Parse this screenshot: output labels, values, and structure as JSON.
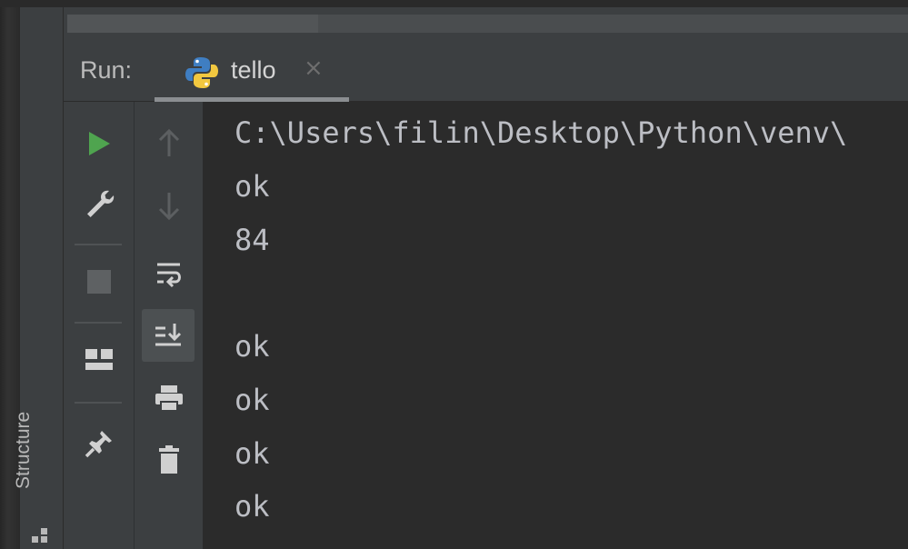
{
  "sidebar": {
    "structure_label": "Structure"
  },
  "run_panel": {
    "label": "Run:",
    "tab": {
      "name": "tello",
      "close_glyph": "×"
    }
  },
  "console": {
    "lines": [
      "C:\\Users\\filin\\Desktop\\Python\\venv\\",
      "ok",
      "84",
      "",
      "ok",
      "ok",
      "ok",
      "ok"
    ]
  },
  "icons": {
    "run": "play-icon",
    "rerun_settings": "wrench-icon",
    "stop": "stop-icon",
    "layout": "layout-icon",
    "pin": "pin-icon",
    "up": "arrow-up-icon",
    "down": "arrow-down-icon",
    "soft_wrap": "soft-wrap-icon",
    "scroll_to_end": "scroll-to-end-icon",
    "print": "print-icon",
    "clear": "trash-icon",
    "python": "python-icon"
  },
  "colors": {
    "run_green": "#4fa44f",
    "console_bg": "#2b2b2b",
    "panel_bg": "#3c3f41",
    "text": "#bcbec4"
  }
}
